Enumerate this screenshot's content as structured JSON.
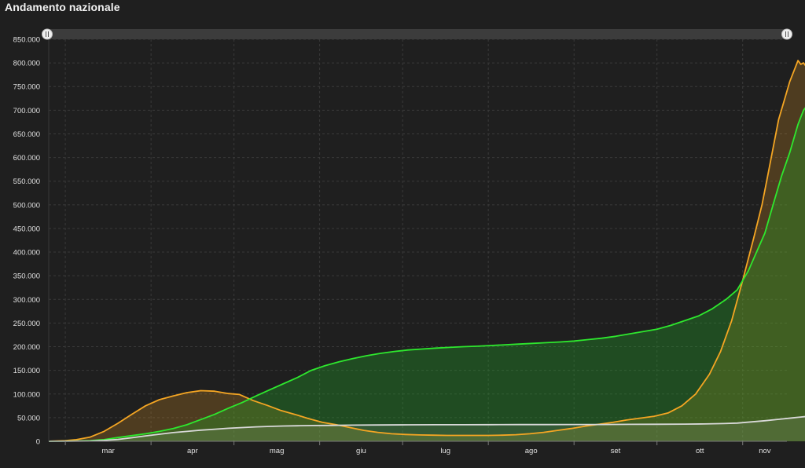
{
  "page": {
    "title": "Andamento nazionale"
  },
  "chart_data": {
    "type": "area",
    "title": "Andamento nazionale",
    "xlabel": "",
    "ylabel": "",
    "x_tick_labels": [
      "mar",
      "apr",
      "mag",
      "giu",
      "lug",
      "ago",
      "set",
      "ott",
      "nov"
    ],
    "y_tick_labels": [
      "0",
      "50.000",
      "100.000",
      "150.000",
      "200.000",
      "250.000",
      "300.000",
      "350.000",
      "400.000",
      "450.000",
      "500.000",
      "550.000",
      "600.000",
      "650.000",
      "700.000",
      "750.000",
      "800.000",
      "850.000"
    ],
    "ylim": [
      0,
      850000
    ],
    "xlim": [
      "2020-02-24",
      "2020-11-17"
    ],
    "grid": true,
    "series": [
      {
        "color": "#f5a623",
        "fill": "rgba(245,166,35,0.22)",
        "points": [
          [
            "2020-02-24",
            200
          ],
          [
            "2020-03-01",
            1500
          ],
          [
            "2020-03-05",
            3500
          ],
          [
            "2020-03-10",
            9000
          ],
          [
            "2020-03-15",
            21000
          ],
          [
            "2020-03-20",
            38000
          ],
          [
            "2020-03-25",
            57000
          ],
          [
            "2020-03-30",
            75000
          ],
          [
            "2020-04-04",
            88000
          ],
          [
            "2020-04-09",
            96000
          ],
          [
            "2020-04-14",
            103000
          ],
          [
            "2020-04-19",
            107000
          ],
          [
            "2020-04-24",
            106000
          ],
          [
            "2020-04-29",
            101000
          ],
          [
            "2020-05-03",
            99000
          ],
          [
            "2020-05-08",
            86000
          ],
          [
            "2020-05-13",
            76000
          ],
          [
            "2020-05-18",
            65000
          ],
          [
            "2020-05-23",
            57000
          ],
          [
            "2020-05-28",
            48000
          ],
          [
            "2020-06-02",
            40000
          ],
          [
            "2020-06-07",
            35000
          ],
          [
            "2020-06-12",
            29000
          ],
          [
            "2020-06-17",
            23000
          ],
          [
            "2020-06-22",
            19000
          ],
          [
            "2020-06-27",
            16000
          ],
          [
            "2020-07-02",
            14500
          ],
          [
            "2020-07-07",
            13500
          ],
          [
            "2020-07-12",
            13000
          ],
          [
            "2020-07-17",
            12500
          ],
          [
            "2020-07-22",
            12500
          ],
          [
            "2020-07-27",
            12500
          ],
          [
            "2020-08-01",
            12500
          ],
          [
            "2020-08-06",
            13000
          ],
          [
            "2020-08-11",
            14000
          ],
          [
            "2020-08-16",
            16000
          ],
          [
            "2020-08-21",
            19000
          ],
          [
            "2020-08-26",
            23000
          ],
          [
            "2020-08-31",
            27000
          ],
          [
            "2020-09-05",
            32000
          ],
          [
            "2020-09-10",
            36000
          ],
          [
            "2020-09-15",
            40000
          ],
          [
            "2020-09-20",
            45000
          ],
          [
            "2020-09-25",
            49000
          ],
          [
            "2020-09-30",
            53000
          ],
          [
            "2020-10-05",
            60000
          ],
          [
            "2020-10-10",
            75000
          ],
          [
            "2020-10-15",
            100000
          ],
          [
            "2020-10-20",
            142000
          ],
          [
            "2020-10-24",
            190000
          ],
          [
            "2020-10-28",
            255000
          ],
          [
            "2020-11-01",
            340000
          ],
          [
            "2020-11-05",
            430000
          ],
          [
            "2020-11-08",
            500000
          ],
          [
            "2020-11-10",
            560000
          ],
          [
            "2020-11-12",
            620000
          ],
          [
            "2020-11-14",
            680000
          ],
          [
            "2020-11-16",
            720000
          ],
          [
            "2020-11-18",
            760000
          ],
          [
            "2020-11-20",
            790000
          ],
          [
            "2020-11-21",
            805000
          ],
          [
            "2020-11-22",
            797000
          ],
          [
            "2020-11-23",
            800000
          ],
          [
            "2020-11-24",
            792000
          ],
          [
            "2020-11-25",
            797000
          ],
          [
            "2020-11-26",
            788000
          ],
          [
            "2020-11-27",
            791000
          ],
          [
            "2020-11-28",
            795000
          ]
        ]
      },
      {
        "color": "#2ee82e",
        "fill": "rgba(34,170,40,0.32)",
        "points": [
          [
            "2020-02-24",
            0
          ],
          [
            "2020-03-05",
            600
          ],
          [
            "2020-03-10",
            1500
          ],
          [
            "2020-03-15",
            3500
          ],
          [
            "2020-03-20",
            8000
          ],
          [
            "2020-03-25",
            12000
          ],
          [
            "2020-03-30",
            16000
          ],
          [
            "2020-04-04",
            21000
          ],
          [
            "2020-04-09",
            27000
          ],
          [
            "2020-04-14",
            35000
          ],
          [
            "2020-04-19",
            46000
          ],
          [
            "2020-04-24",
            57000
          ],
          [
            "2020-04-29",
            70000
          ],
          [
            "2020-05-04",
            82000
          ],
          [
            "2020-05-09",
            96000
          ],
          [
            "2020-05-14",
            109000
          ],
          [
            "2020-05-19",
            122000
          ],
          [
            "2020-05-24",
            135000
          ],
          [
            "2020-05-29",
            150000
          ],
          [
            "2020-06-03",
            160000
          ],
          [
            "2020-06-08",
            168000
          ],
          [
            "2020-06-13",
            175000
          ],
          [
            "2020-06-18",
            181000
          ],
          [
            "2020-06-23",
            186000
          ],
          [
            "2020-06-28",
            190000
          ],
          [
            "2020-07-03",
            193000
          ],
          [
            "2020-07-08",
            195000
          ],
          [
            "2020-07-13",
            197000
          ],
          [
            "2020-07-18",
            198500
          ],
          [
            "2020-07-23",
            200000
          ],
          [
            "2020-07-28",
            201000
          ],
          [
            "2020-08-02",
            202500
          ],
          [
            "2020-08-07",
            204000
          ],
          [
            "2020-08-12",
            205500
          ],
          [
            "2020-08-17",
            207000
          ],
          [
            "2020-08-22",
            208500
          ],
          [
            "2020-08-27",
            210000
          ],
          [
            "2020-09-01",
            212000
          ],
          [
            "2020-09-06",
            215000
          ],
          [
            "2020-09-11",
            218000
          ],
          [
            "2020-09-16",
            222000
          ],
          [
            "2020-09-21",
            227000
          ],
          [
            "2020-09-26",
            232000
          ],
          [
            "2020-10-01",
            237000
          ],
          [
            "2020-10-06",
            245000
          ],
          [
            "2020-10-11",
            255000
          ],
          [
            "2020-10-16",
            265000
          ],
          [
            "2020-10-21",
            280000
          ],
          [
            "2020-10-26",
            300000
          ],
          [
            "2020-10-30",
            320000
          ],
          [
            "2020-11-03",
            360000
          ],
          [
            "2020-11-06",
            400000
          ],
          [
            "2020-11-09",
            440000
          ],
          [
            "2020-11-12",
            500000
          ],
          [
            "2020-11-15",
            560000
          ],
          [
            "2020-11-18",
            610000
          ],
          [
            "2020-11-21",
            670000
          ],
          [
            "2020-11-23",
            700000
          ],
          [
            "2020-11-25",
            715000
          ],
          [
            "2020-11-28",
            733000
          ]
        ]
      },
      {
        "color": "#d9d9d9",
        "fill": "rgba(200,200,200,0.12)",
        "points": [
          [
            "2020-02-24",
            0
          ],
          [
            "2020-03-01",
            100
          ],
          [
            "2020-03-10",
            600
          ],
          [
            "2020-03-15",
            1800
          ],
          [
            "2020-03-20",
            4000
          ],
          [
            "2020-03-25",
            7500
          ],
          [
            "2020-03-30",
            11500
          ],
          [
            "2020-04-04",
            15000
          ],
          [
            "2020-04-09",
            18500
          ],
          [
            "2020-04-14",
            21000
          ],
          [
            "2020-04-19",
            23500
          ],
          [
            "2020-04-24",
            25500
          ],
          [
            "2020-04-29",
            27500
          ],
          [
            "2020-05-04",
            29000
          ],
          [
            "2020-05-09",
            30500
          ],
          [
            "2020-05-14",
            31500
          ],
          [
            "2020-05-19",
            32300
          ],
          [
            "2020-05-24",
            32800
          ],
          [
            "2020-05-29",
            33300
          ],
          [
            "2020-06-03",
            33600
          ],
          [
            "2020-06-13",
            34200
          ],
          [
            "2020-06-23",
            34600
          ],
          [
            "2020-07-03",
            34800
          ],
          [
            "2020-07-13",
            34950
          ],
          [
            "2020-07-23",
            35100
          ],
          [
            "2020-08-02",
            35200
          ],
          [
            "2020-08-12",
            35300
          ],
          [
            "2020-08-22",
            35400
          ],
          [
            "2020-09-01",
            35500
          ],
          [
            "2020-09-11",
            35600
          ],
          [
            "2020-09-21",
            35800
          ],
          [
            "2020-10-01",
            36000
          ],
          [
            "2020-10-11",
            36300
          ],
          [
            "2020-10-18",
            36700
          ],
          [
            "2020-10-25",
            37500
          ],
          [
            "2020-10-30",
            38500
          ],
          [
            "2020-11-04",
            41000
          ],
          [
            "2020-11-09",
            43500
          ],
          [
            "2020-11-14",
            46500
          ],
          [
            "2020-11-19",
            49500
          ],
          [
            "2020-11-24",
            52500
          ],
          [
            "2020-11-28",
            55000
          ]
        ]
      }
    ],
    "colors": {
      "background": "#1f1f1f",
      "grid": "#3a3a3a",
      "axis": "#7a7a7a",
      "tick_text": "#e0e0e0",
      "navigator_track": "#3c3c3c",
      "navigator_handle": "#f0f0f0"
    }
  }
}
